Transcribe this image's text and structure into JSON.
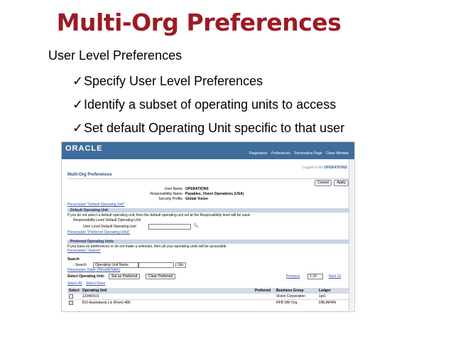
{
  "slide": {
    "title": "Multi-Org Preferences",
    "subtitle": "User Level Preferences",
    "bullets": [
      "Specify User Level Preferences",
      "Identify a subset of operating units to access",
      "Set default Operating Unit specific to that user"
    ],
    "check_glyph": "✓"
  },
  "app": {
    "brand": "ORACLE",
    "nav": [
      "Diagnostics",
      "Preferences",
      "Personalize Page",
      "Close Window"
    ],
    "logged_in_prefix": "Logged In As",
    "logged_in_user": "OPERATIONS",
    "page_title": "Multi-Org Preferences",
    "buttons": {
      "cancel": "Cancel",
      "apply": "Apply"
    },
    "info": [
      {
        "label": "User Name",
        "value": "OPERATIONS"
      },
      {
        "label": "Responsibility Name",
        "value": "Payables, Vision Operations (USA)"
      },
      {
        "label": "Security Profile",
        "value": "Global Vision"
      }
    ],
    "personalize_default": "Personalize \"Default Operating Unit\"",
    "default_section": "Default Operating Unit",
    "default_note": "If you do not select a default operating unit, then the default operating unit set at the Responsibility level will be used.",
    "resp_default_label": "Responsibility Level Default Operating Unit",
    "user_default_label": "User Level Default Operating Unit",
    "personalize_preferred": "Personalize \"Preferred Operating Units\"",
    "preferred_section": "Preferred Operating Units",
    "preferred_note": "If you have no preferences or do not make a selection, then all your operating units will be accessible.",
    "personalize_search": "Personalize \"Search\"",
    "search_label": "Search",
    "search_field_label": "- Search",
    "search_select": "Operating Unit Name",
    "go": "Go",
    "personalize_table": "Personalize Table: (ResultsTable)",
    "select_label": "Select Operating Unit:",
    "set_preferred": "Set as Preferred",
    "clear_preferred": "Clear Preferred",
    "prev": "Previous",
    "page_range": "1-10",
    "next": "Next 10",
    "select_all": "Select All",
    "select_none": "Select None",
    "columns": [
      "Select",
      "Operating Unit",
      "Preferred",
      "Business Group",
      "Ledger"
    ],
    "rows": [
      {
        "ou": "12345OU1",
        "bg": "Vision Corporation",
        "ledger": "1pt1",
        "checked": false
      },
      {
        "ou": "810-Australasia Lic (Rom)-480",
        "bg": "RFB DBI Org",
        "ledger": "DBIJAPAN",
        "checked": true
      }
    ]
  }
}
